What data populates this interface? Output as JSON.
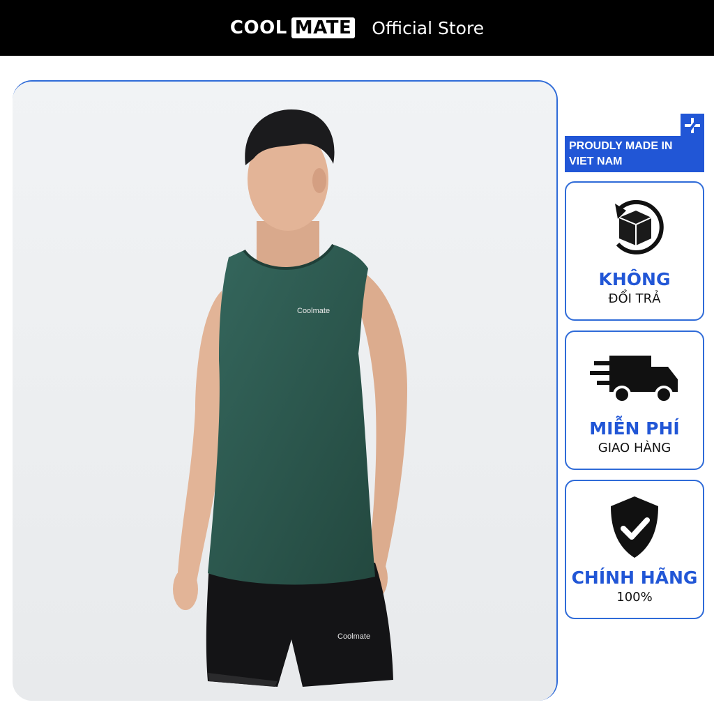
{
  "header": {
    "brand_part1": "COOL",
    "brand_part2": "MATE",
    "store_label": "Official Store"
  },
  "product_photo": {
    "shirt_logo": "Coolmate",
    "shorts_logo": "Coolmate",
    "shirt_color": "#2c5a52"
  },
  "badges": {
    "made_in": "PROUDLY MADE IN VIET NAM",
    "made_in_icon": "plus-slash-icon",
    "cards": [
      {
        "icon": "return-box-icon",
        "title": "KHÔNG",
        "subtitle": "ĐỔI TRẢ"
      },
      {
        "icon": "delivery-truck-icon",
        "title": "MIỄN PHÍ",
        "subtitle": "GIAO HÀNG"
      },
      {
        "icon": "shield-check-icon",
        "title": "CHÍNH HÃNG",
        "subtitle": "100%"
      }
    ]
  },
  "colors": {
    "accent": "#2156d6",
    "header_bg": "#000000"
  }
}
